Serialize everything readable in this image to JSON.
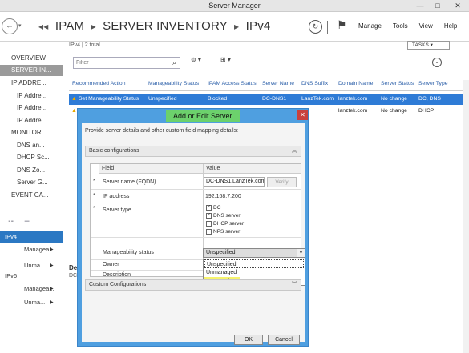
{
  "window": {
    "title": "Server Manager",
    "minimize": "—",
    "maximize": "□",
    "close": "✕"
  },
  "nav": {
    "back_icon": "arrow-left-icon",
    "breadcrumb": [
      "IPAM",
      "SERVER INVENTORY",
      "IPv4"
    ],
    "breadcrumb_prefix": "◂◂",
    "breadcrumb_sep": "▸",
    "refresh_icon": "refresh-icon",
    "flag_icon": "flag-icon",
    "menus": [
      "Manage",
      "Tools",
      "View",
      "Help"
    ]
  },
  "sidebar": {
    "items": [
      {
        "label": "OVERVIEW",
        "indent": false,
        "selected": false
      },
      {
        "label": "SERVER IN...",
        "indent": false,
        "selected": true
      },
      {
        "label": "IP ADDRE...",
        "indent": false,
        "selected": false
      },
      {
        "label": "IP Addre...",
        "indent": true,
        "selected": false
      },
      {
        "label": "IP Addre...",
        "indent": true,
        "selected": false
      },
      {
        "label": "IP Addre...",
        "indent": true,
        "selected": false
      },
      {
        "label": "MONITOR...",
        "indent": false,
        "selected": false
      },
      {
        "label": "DNS an...",
        "indent": true,
        "selected": false
      },
      {
        "label": "DHCP Sc...",
        "indent": true,
        "selected": false
      },
      {
        "label": "DNS Zo...",
        "indent": true,
        "selected": false
      },
      {
        "label": "Server G...",
        "indent": true,
        "selected": false
      },
      {
        "label": "EVENT CA...",
        "indent": false,
        "selected": false
      }
    ],
    "views": [
      {
        "label": "IPv4",
        "selected": true,
        "arrow": false,
        "sub": false
      },
      {
        "label": "Managea...",
        "selected": false,
        "arrow": true,
        "sub": true
      },
      {
        "label": "Unma...",
        "selected": false,
        "arrow": true,
        "sub": true
      },
      {
        "label": "IPv6",
        "selected": false,
        "arrow": false,
        "sub": false
      },
      {
        "label": "Managea...",
        "selected": false,
        "arrow": true,
        "sub": true
      },
      {
        "label": "Unma...",
        "selected": false,
        "arrow": true,
        "sub": true
      }
    ]
  },
  "toolbar": {
    "count": "IPv4 | 2 total",
    "tasks": "TASKS ▾",
    "filter_placeholder": "Filter",
    "search_icon": "search-icon",
    "list_icon": "⊜ ▾",
    "save_icon": "⊞ ▾",
    "expand_icon": "⌄"
  },
  "grid": {
    "columns": [
      "Recommended Action",
      "Manageability Status",
      "IPAM Access Status",
      "Server Name",
      "DNS Suffix",
      "Domain Name",
      "Server Status",
      "Server Type"
    ],
    "rows": [
      {
        "action": "Set Manageability Status",
        "manageability": "Unspecified",
        "access": "Blocked",
        "name": "DC-DNS1",
        "suffix": "LanzTek.com",
        "domain": "lanztek.com",
        "status": "No change",
        "type": "DC, DNS",
        "selected": true
      },
      {
        "action": "",
        "manageability": "",
        "access": "",
        "name": "",
        "suffix": "",
        "domain": "lanztek.com",
        "status": "No change",
        "type": "DHCP",
        "selected": false
      }
    ]
  },
  "dialog": {
    "title": "Add or Edit Server",
    "instructions": "Provide server details and other custom field mapping details:",
    "basic_section": "Basic configurations",
    "custom_section": "Custom Configurations",
    "table": {
      "col_field": "Field",
      "col_value": "Value"
    },
    "fields": {
      "fqdn_label": "Server name (FQDN)",
      "fqdn_value": "DC-DNS1.LanzTek.com",
      "verify": "Verify",
      "ip_label": "IP address",
      "ip_value": "192.168.7.200",
      "type_label": "Server type",
      "types": [
        {
          "label": "DC",
          "checked": true
        },
        {
          "label": "DNS server",
          "checked": true
        },
        {
          "label": "DHCP server",
          "checked": false
        },
        {
          "label": "NPS server",
          "checked": false
        }
      ],
      "manage_label": "Manageability status",
      "manage_value": "Unspecified",
      "manage_options": [
        "Unspecified",
        "Unmanaged",
        "Managed"
      ],
      "owner_label": "Owner",
      "desc_label": "Description"
    },
    "ok": "OK",
    "cancel": "Cancel"
  },
  "bottom": {
    "frag1": "De",
    "frag2": "DC"
  },
  "colors": {
    "accent": "#2e7bd6",
    "dialog_border": "#4f9fe0",
    "title_highlight": "#6cd16c",
    "option_highlight": "#f6f36c",
    "close": "#c9413d"
  }
}
